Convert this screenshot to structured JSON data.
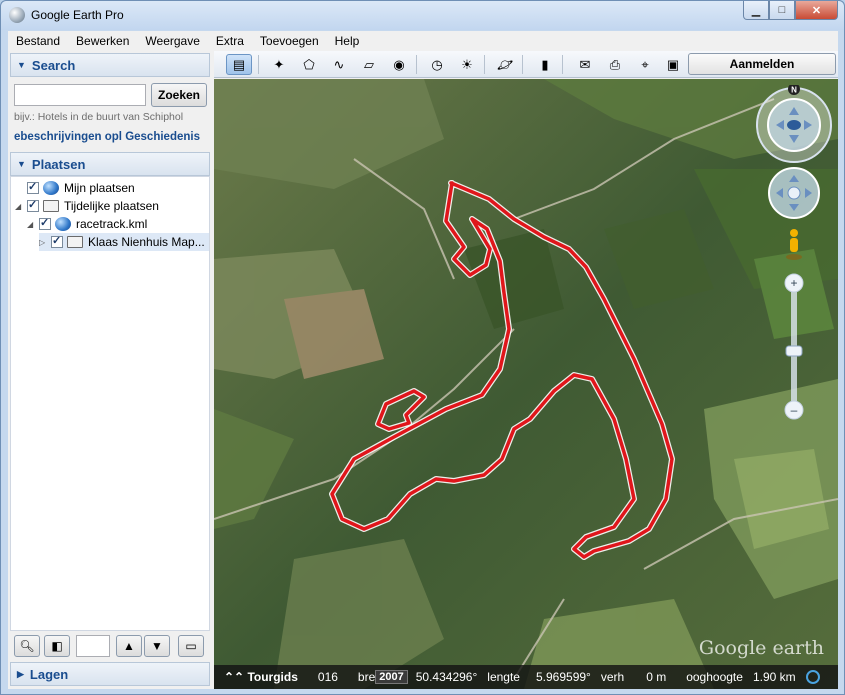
{
  "window": {
    "title": "Google Earth Pro",
    "minimize": "▁",
    "maximize": "□",
    "close": "✕"
  },
  "menu": [
    "Bestand",
    "Bewerken",
    "Weergave",
    "Extra",
    "Toevoegen",
    "Help"
  ],
  "search": {
    "header": "Search",
    "input_value": "",
    "button": "Zoeken",
    "hint": "bijv.: Hotels in de buurt van Schiphol",
    "links": "ebeschrijvingen opl Geschiedenis"
  },
  "places": {
    "header": "Plaatsen",
    "items": [
      {
        "label": "Mijn plaatsen",
        "icon": "globe-icon"
      },
      {
        "label": "Tijdelijke plaatsen",
        "icon": "folder-icon"
      },
      {
        "label": "racetrack.kml",
        "icon": "globe-icon"
      },
      {
        "label": "Klaas Nienhuis Map...",
        "icon": "folder-icon"
      }
    ]
  },
  "layers": {
    "header": "Lagen"
  },
  "toolbar": {
    "signin": "Aanmelden"
  },
  "map": {
    "watermark": "Google earth",
    "compass_north": "N",
    "status": {
      "tour": "Tourgids",
      "year_fragment": "016",
      "year_label": "bre",
      "year_badge": "2007",
      "lat": "50.434296°",
      "lon_label": "lengte",
      "lon": "5.969599°",
      "elev_label": "verh",
      "elev": "0 m",
      "eye_label": "ooghoogte",
      "eye": "1.90 km"
    }
  },
  "colors": {
    "track": "#e0161b",
    "accent": "#1a4d8f"
  }
}
